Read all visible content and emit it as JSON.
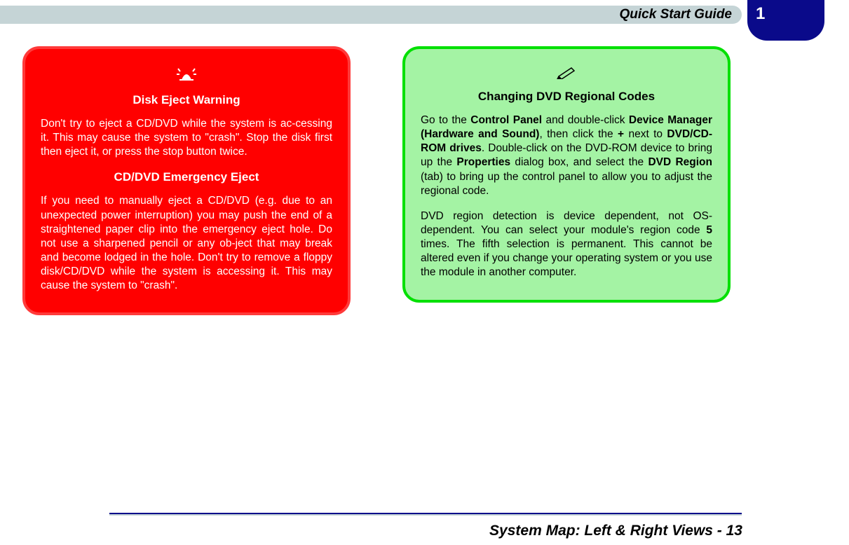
{
  "header": {
    "title": "Quick Start Guide",
    "chapter": "1"
  },
  "red_card": {
    "icon": "沴",
    "title1": "Disk Eject Warning",
    "para1": "Don't try to eject a CD/DVD while the system is ac-cessing it. This may cause the system to \"crash\". Stop the disk first then eject it, or press the stop button twice.",
    "title2": "CD/DVD Emergency Eject",
    "para2": "If you need to manually eject a CD/DVD (e.g. due to an unexpected power interruption) you may push the end of a straightened paper clip into the emergency eject hole. Do not use a sharpened pencil or any ob-ject that may break and become lodged in the hole. Don't try to remove a floppy disk/CD/DVD while the system is accessing it. This may cause the system to \"crash\"."
  },
  "green_card": {
    "icon": "✎",
    "title": "Changing DVD Regional Codes",
    "p1_a": "Go to the ",
    "p1_b": "Control Panel",
    "p1_c": " and double-click ",
    "p1_d": "Device Manager (Hardware and Sound)",
    "p1_e": ", then click the ",
    "p1_f": "+",
    "p1_g": " next to ",
    "p1_h": "DVD/CD-ROM drives",
    "p1_i": ". Double-click on the DVD-ROM device to bring up the ",
    "p1_j": "Properties",
    "p1_k": " dialog box, and select the ",
    "p1_l": "DVD Region",
    "p1_m": " (tab) to bring up the control panel to allow you to adjust the regional code.",
    "p2_a": "DVD region detection is device dependent, not OS-dependent. You can select your module's region code ",
    "p2_b": "5",
    "p2_c": " times. The fifth selection is permanent. This cannot be altered even if you change your operating system or you use the module in another computer."
  },
  "footer": {
    "text": "System Map: Left & Right Views - 13"
  }
}
